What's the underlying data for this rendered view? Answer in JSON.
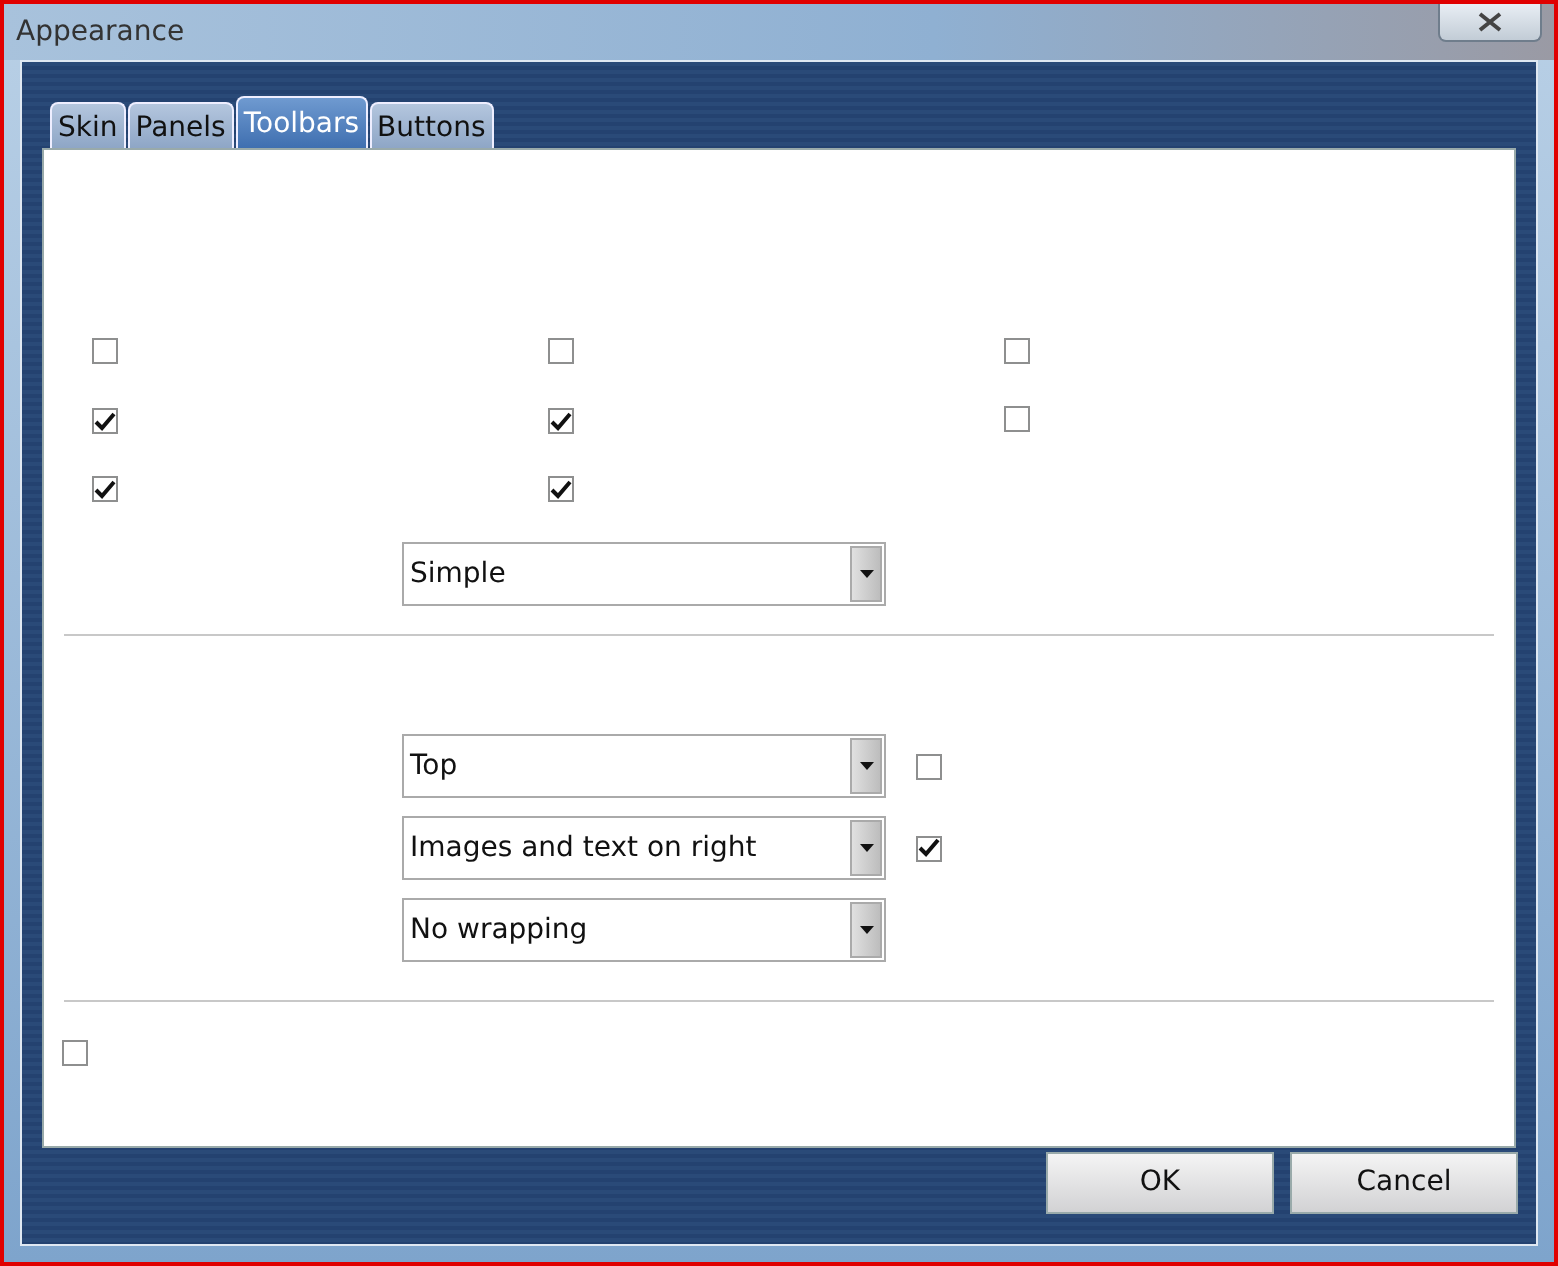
{
  "window": {
    "title": "Appearance"
  },
  "tabs": [
    {
      "label": "Skin",
      "selected": false
    },
    {
      "label": "Panels",
      "selected": false
    },
    {
      "label": "Toolbars",
      "selected": true
    },
    {
      "label": "Buttons",
      "selected": false
    }
  ],
  "checkbox_grid": [
    [
      {
        "checked": false
      },
      {
        "checked": false
      },
      {
        "checked": false
      }
    ],
    [
      {
        "checked": true
      },
      {
        "checked": true
      },
      {
        "checked": false
      }
    ],
    [
      {
        "checked": true
      },
      {
        "checked": true
      }
    ]
  ],
  "style_dropdown": {
    "value": "Simple"
  },
  "toolbar_rows": [
    {
      "value": "Top",
      "checkbox": {
        "checked": false
      }
    },
    {
      "value": "Images and text on right",
      "checkbox": {
        "checked": true
      }
    },
    {
      "value": "No wrapping"
    }
  ],
  "bottom_checkbox": {
    "checked": false
  },
  "buttons": [
    "OK",
    "Cancel"
  ]
}
